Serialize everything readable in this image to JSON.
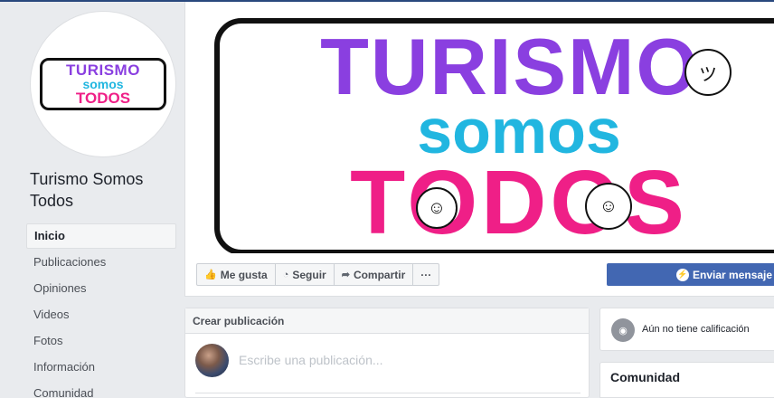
{
  "page": {
    "name": "Turismo Somos Todos"
  },
  "logo": {
    "line1": "TURISMO",
    "line2": "somos",
    "line3": "TODOS"
  },
  "sidebar": {
    "items": [
      {
        "label": "Inicio",
        "active": true
      },
      {
        "label": "Publicaciones"
      },
      {
        "label": "Opiniones"
      },
      {
        "label": "Videos"
      },
      {
        "label": "Fotos"
      },
      {
        "label": "Información"
      },
      {
        "label": "Comunidad"
      }
    ]
  },
  "actions": {
    "like": "Me gusta",
    "follow": "Seguir",
    "share": "Compartir",
    "more": "···",
    "message": "Enviar mensaje"
  },
  "composer": {
    "title": "Crear publicación",
    "placeholder": "Escribe una publicación..."
  },
  "rating": {
    "text": "Aún no tiene calificación"
  },
  "community": {
    "title": "Comunidad"
  },
  "icons": {
    "like": "thumbs-up-icon",
    "follow": "rss-icon",
    "share": "share-arrow-icon",
    "message": "messenger-icon",
    "rating": "chat-bubble-icon"
  },
  "colors": {
    "brand_blue": "#4267b2",
    "purple": "#8a3fe0",
    "cyan": "#21b6e0",
    "pink": "#ef1f87"
  }
}
